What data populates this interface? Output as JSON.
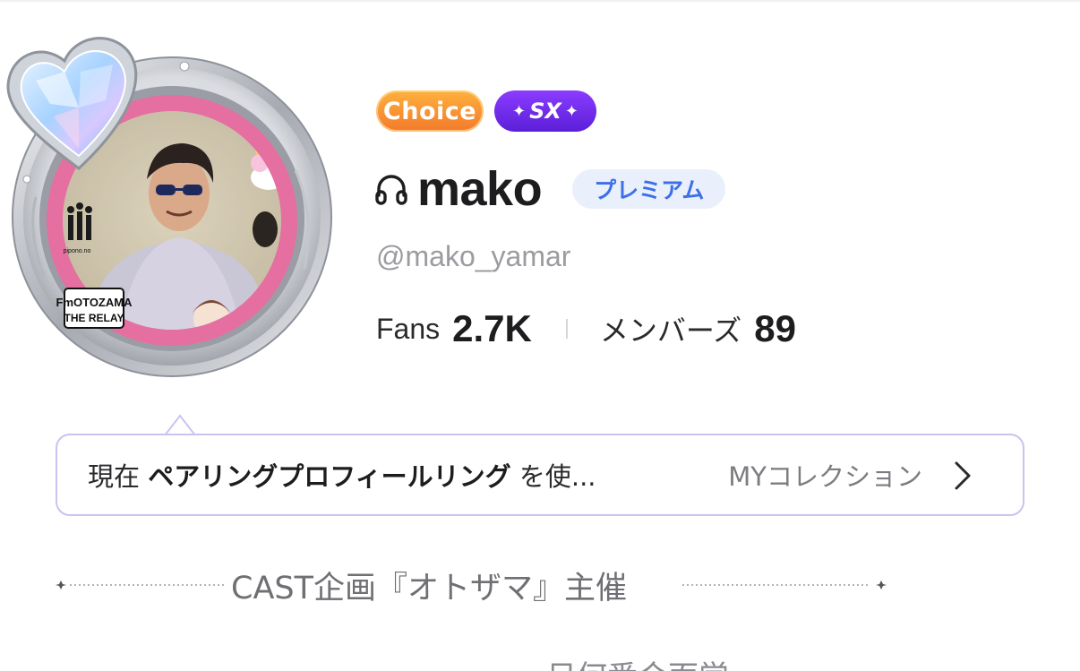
{
  "profile": {
    "badges": {
      "choice": "Choice",
      "sx": "SX"
    },
    "username": "mako",
    "premium_label": "プレミアム",
    "handle": "@mako_yamar",
    "stats": {
      "fans_label": "Fans",
      "fans_value": "2.7K",
      "members_label": "メンバーズ",
      "members_value": "89"
    },
    "avatar": {
      "logo_line1": "FmOTOZAMA",
      "logo_line2": "THE RELAY",
      "small_text": "pipono.no"
    }
  },
  "collection_banner": {
    "prefix": "現在",
    "item_name": "ペアリングプロフィールリング",
    "suffix": "を使...",
    "link_label": "MYコレクション"
  },
  "tagline": "CAST企画『オトザマ』主催",
  "bottom_partial_text": "日何番合面営",
  "colors": {
    "choice_orange": "#f27a2c",
    "sx_purple": "#5b1fd8",
    "premium_blue": "#3c6fe8",
    "banner_border": "#c8c4f0"
  },
  "icons": [
    "headphones-icon",
    "chevron-right-icon",
    "heart-gem-icon",
    "sparkle-icon"
  ]
}
